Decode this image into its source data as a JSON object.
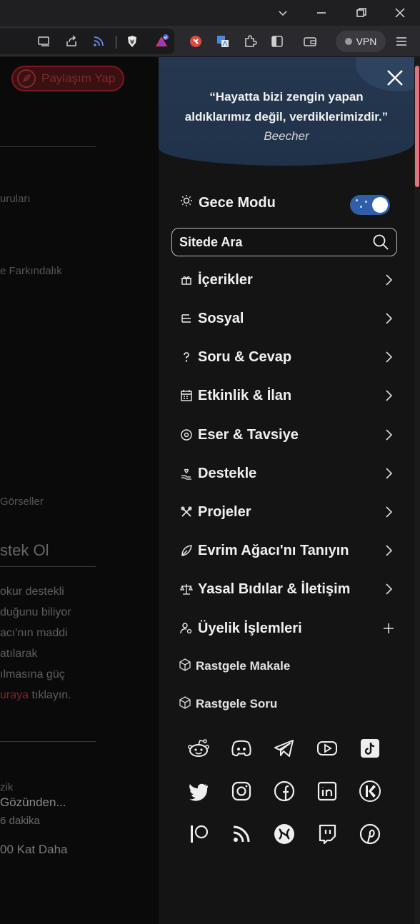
{
  "browser": {
    "vpn_label": "VPN",
    "toolbar_icons": [
      "cast-icon",
      "share-icon",
      "rss-icon",
      "brave-shield-icon",
      "brave-rewards-icon",
      "extension-red-icon",
      "translate-icon",
      "puzzle-icon",
      "sidebar-icon",
      "wallet-icon",
      "menu-icon"
    ],
    "window_controls": [
      "chevron-down-icon",
      "minimize-icon",
      "restore-icon",
      "close-icon"
    ]
  },
  "background_page": {
    "share_button": "Paylaşım Yap",
    "fragments": [
      "uruları",
      "e Farkındalık",
      "Görseller"
    ],
    "heading": "stek Ol",
    "paragraph": [
      "okur destekli",
      "duğunu biliyor",
      "acı'nın maddi",
      "atılarak",
      "ılmasına güç"
    ],
    "paragraph_link": "uraya",
    "paragraph_link_tail": " tıklayın.",
    "article": {
      "line1": "zik",
      "line2": "Gözünden...",
      "meta": "6 dakika",
      "line3": "00 Kat Daha"
    }
  },
  "panel": {
    "quote_line1": "“Hayatta bizi zengin yapan",
    "quote_line2": "aldıklarımız değil, verdiklerimizdir.”",
    "quote_author": "Beecher",
    "night_mode_label": "Gece Modu",
    "night_mode_on": true,
    "search_placeholder": "Sitede Ara",
    "menu": [
      {
        "label": "İçerikler",
        "icon": "gift-icon"
      },
      {
        "label": "Sosyal",
        "icon": "layers-icon"
      },
      {
        "label": "Soru & Cevap",
        "icon": "question-icon"
      },
      {
        "label": "Etkinlik & İlan",
        "icon": "calendar-icon"
      },
      {
        "label": "Eser & Tavsiye",
        "icon": "disc-icon"
      },
      {
        "label": "Destekle",
        "icon": "hand-heart-icon"
      },
      {
        "label": "Projeler",
        "icon": "tools-icon"
      },
      {
        "label": "Evrim Ağacı'nı Tanıyın",
        "icon": "leaf-icon"
      },
      {
        "label": "Yasal Bıdılar & İletişim",
        "icon": "scale-icon"
      },
      {
        "label": "Üyelik İşlemleri",
        "icon": "user-gear-icon"
      }
    ],
    "random_article": "Rastgele Makale",
    "random_question": "Rastgele Soru",
    "socials": [
      "reddit-icon",
      "discord-icon",
      "telegram-icon",
      "youtube-icon",
      "tiktok-icon",
      "twitter-icon",
      "instagram-icon",
      "facebook-icon",
      "linkedin-icon",
      "kick-icon",
      "patreon-icon",
      "rss-icon",
      "opencollective-icon",
      "twitch-icon",
      "pinterest-icon"
    ],
    "accent_color": "#e2737a",
    "quote_bg": "#23364d"
  }
}
